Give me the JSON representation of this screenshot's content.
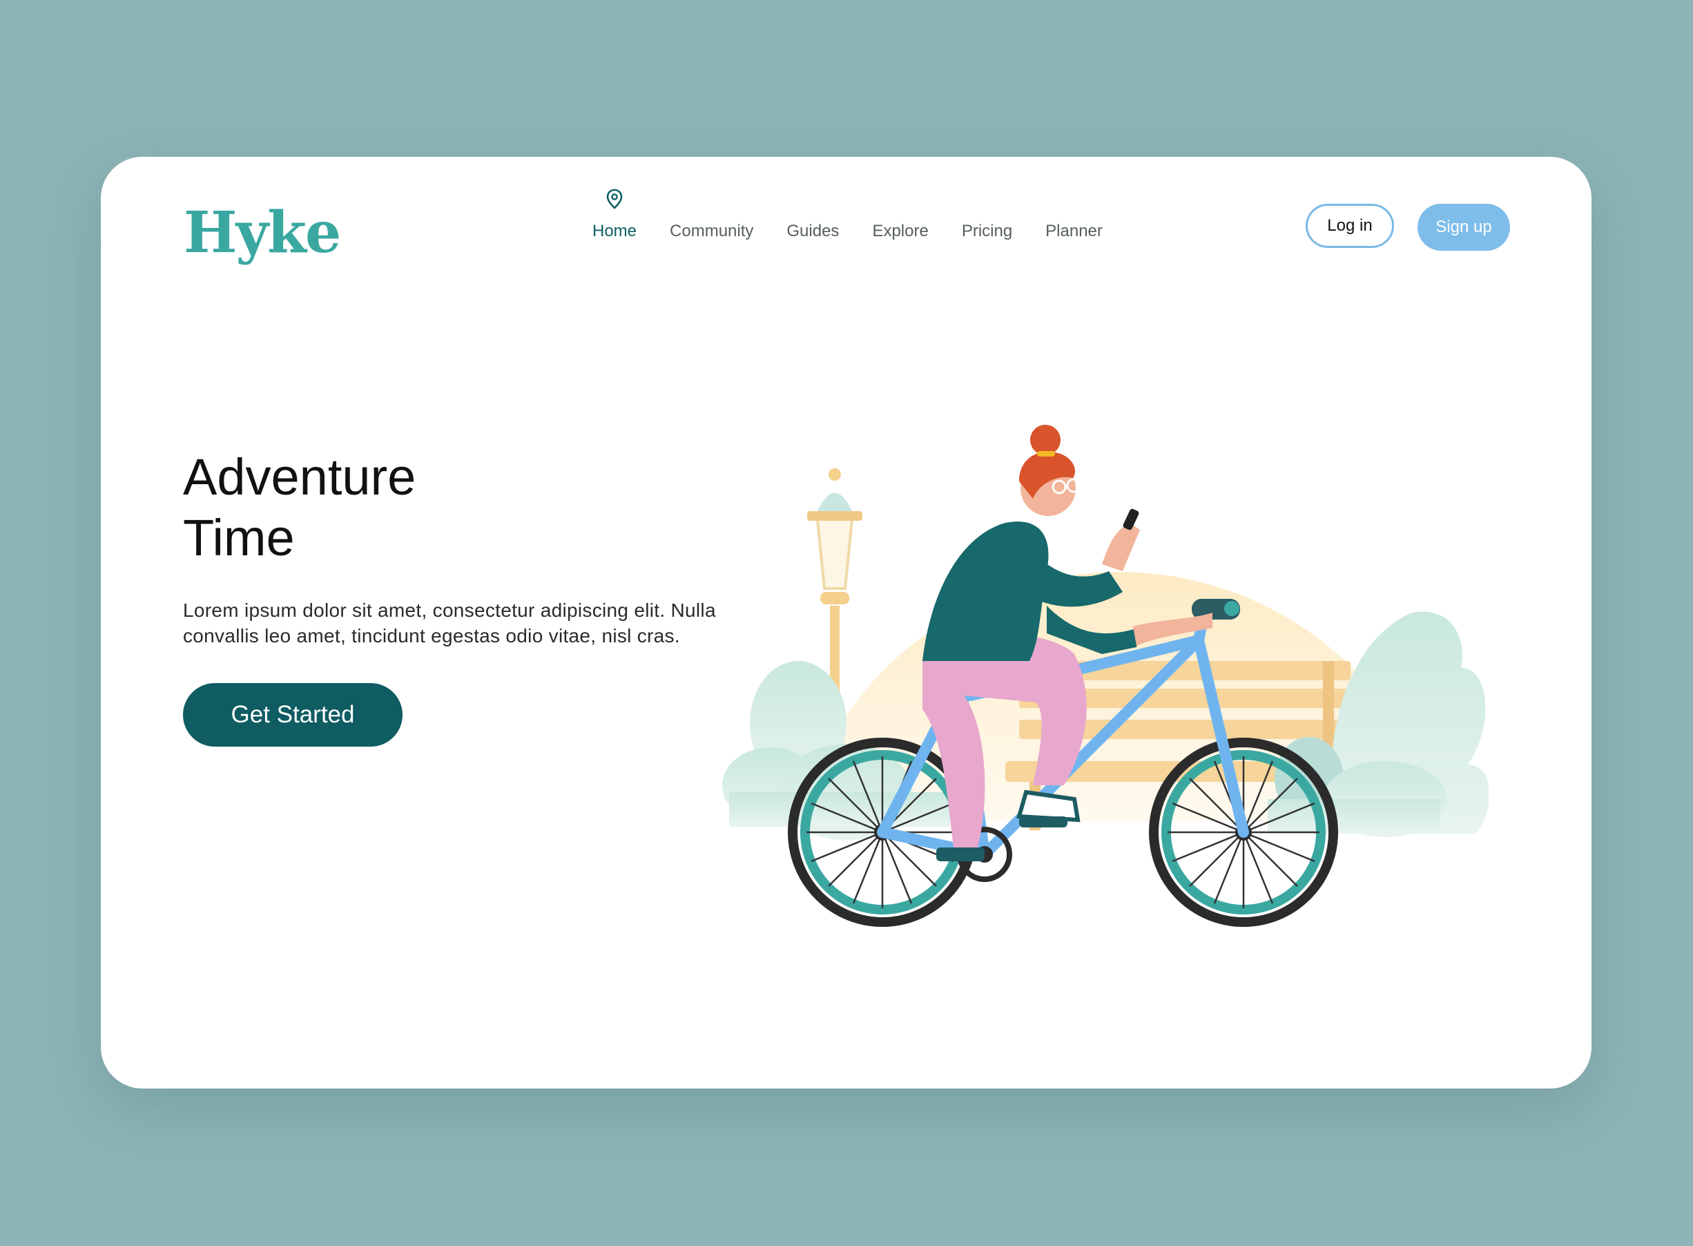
{
  "brand": {
    "logo_text": "Hyke",
    "accent": "#3aa8a1",
    "dark_accent": "#0f5c62"
  },
  "nav": {
    "items": [
      {
        "label": "Home",
        "active": true,
        "icon": "location-pin-icon"
      },
      {
        "label": "Community"
      },
      {
        "label": "Guides"
      },
      {
        "label": "Explore"
      },
      {
        "label": "Pricing"
      },
      {
        "label": "Planner"
      }
    ]
  },
  "auth": {
    "login_label": "Log in",
    "signup_label": "Sign up",
    "signup_color": "#7ebde9"
  },
  "hero": {
    "title_line1": "Adventure",
    "title_line2": "Time",
    "body": "Lorem ipsum dolor sit amet, consectetur adipiscing elit. Nulla convallis leo amet, tincidunt egestas odio vitae, nisl cras.",
    "cta_label": "Get Started"
  },
  "illustration": {
    "name": "woman-cycling-in-park-illustration"
  },
  "colors": {
    "page_background": "#8cb3b6",
    "card_background": "#ffffff"
  }
}
